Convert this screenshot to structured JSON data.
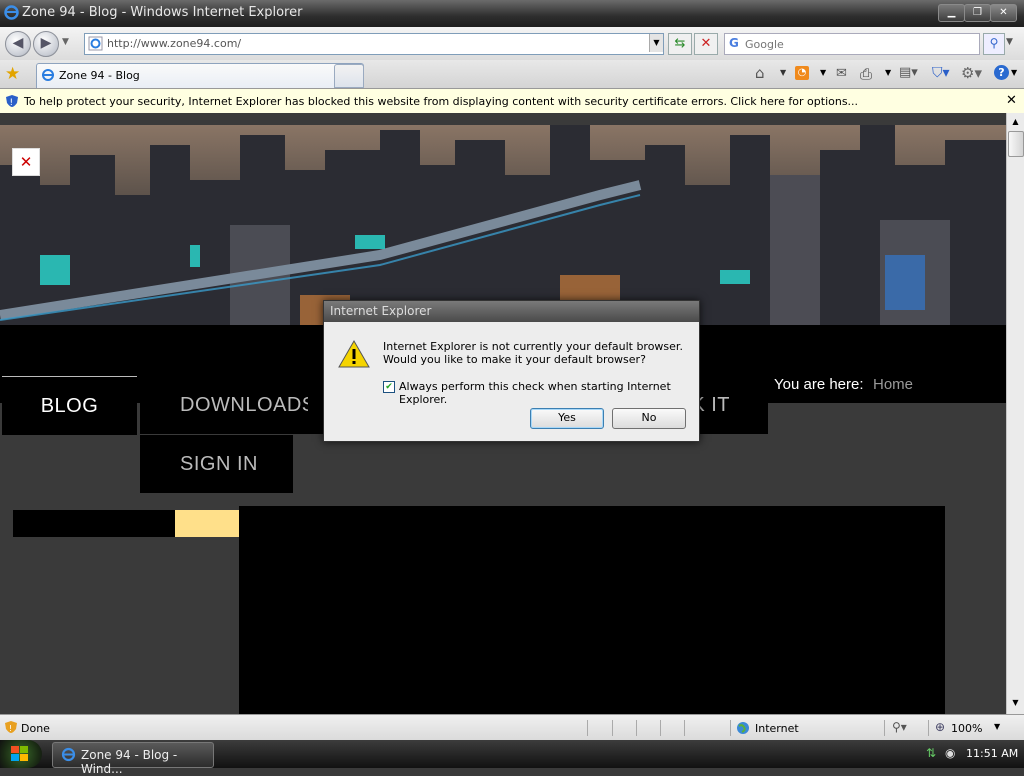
{
  "window": {
    "title": "Zone 94 - Blog - Windows Internet Explorer"
  },
  "address": {
    "url": "http://www.zone94.com/"
  },
  "search": {
    "placeholder": "Google"
  },
  "tabs": [
    {
      "label": "Zone 94 - Blog"
    }
  ],
  "infobar": {
    "text": "To help protect your security, Internet Explorer has blocked this website from displaying content with security certificate errors. Click here for options..."
  },
  "page": {
    "nav": {
      "blog": "BLOG",
      "downloads": "DOWNLOADS",
      "check_it_partial": "K IT",
      "sign_in": "SIGN IN"
    },
    "breadcrumb": {
      "label": "You are here:",
      "home": "Home"
    }
  },
  "dialog": {
    "title": "Internet Explorer",
    "message": "Internet Explorer is not currently your default browser. Would you like to make it your default browser?",
    "checkbox_label": "Always perform this check when starting Internet Explorer.",
    "checkbox_checked": true,
    "yes": "Yes",
    "no": "No"
  },
  "status": {
    "text": "Done",
    "zone": "Internet",
    "zoom": "100%"
  },
  "taskbar": {
    "item": "Zone 94 - Blog - Wind...",
    "clock": "11:51 AM"
  },
  "colors": {
    "accent_yellow": "#ffe08a",
    "infobar": "#ffffe1"
  },
  "icons": [
    "ie-logo-icon",
    "back-icon",
    "forward-icon",
    "refresh-icon",
    "stop-icon",
    "search-icon",
    "favorites-star-icon",
    "home-icon",
    "rss-icon",
    "mail-icon",
    "print-icon",
    "page-icon",
    "safety-icon",
    "tools-gear-icon",
    "help-icon",
    "shield-icon",
    "close-icon",
    "warning-icon",
    "globe-icon",
    "zoom-icon",
    "windows-logo-icon"
  ]
}
